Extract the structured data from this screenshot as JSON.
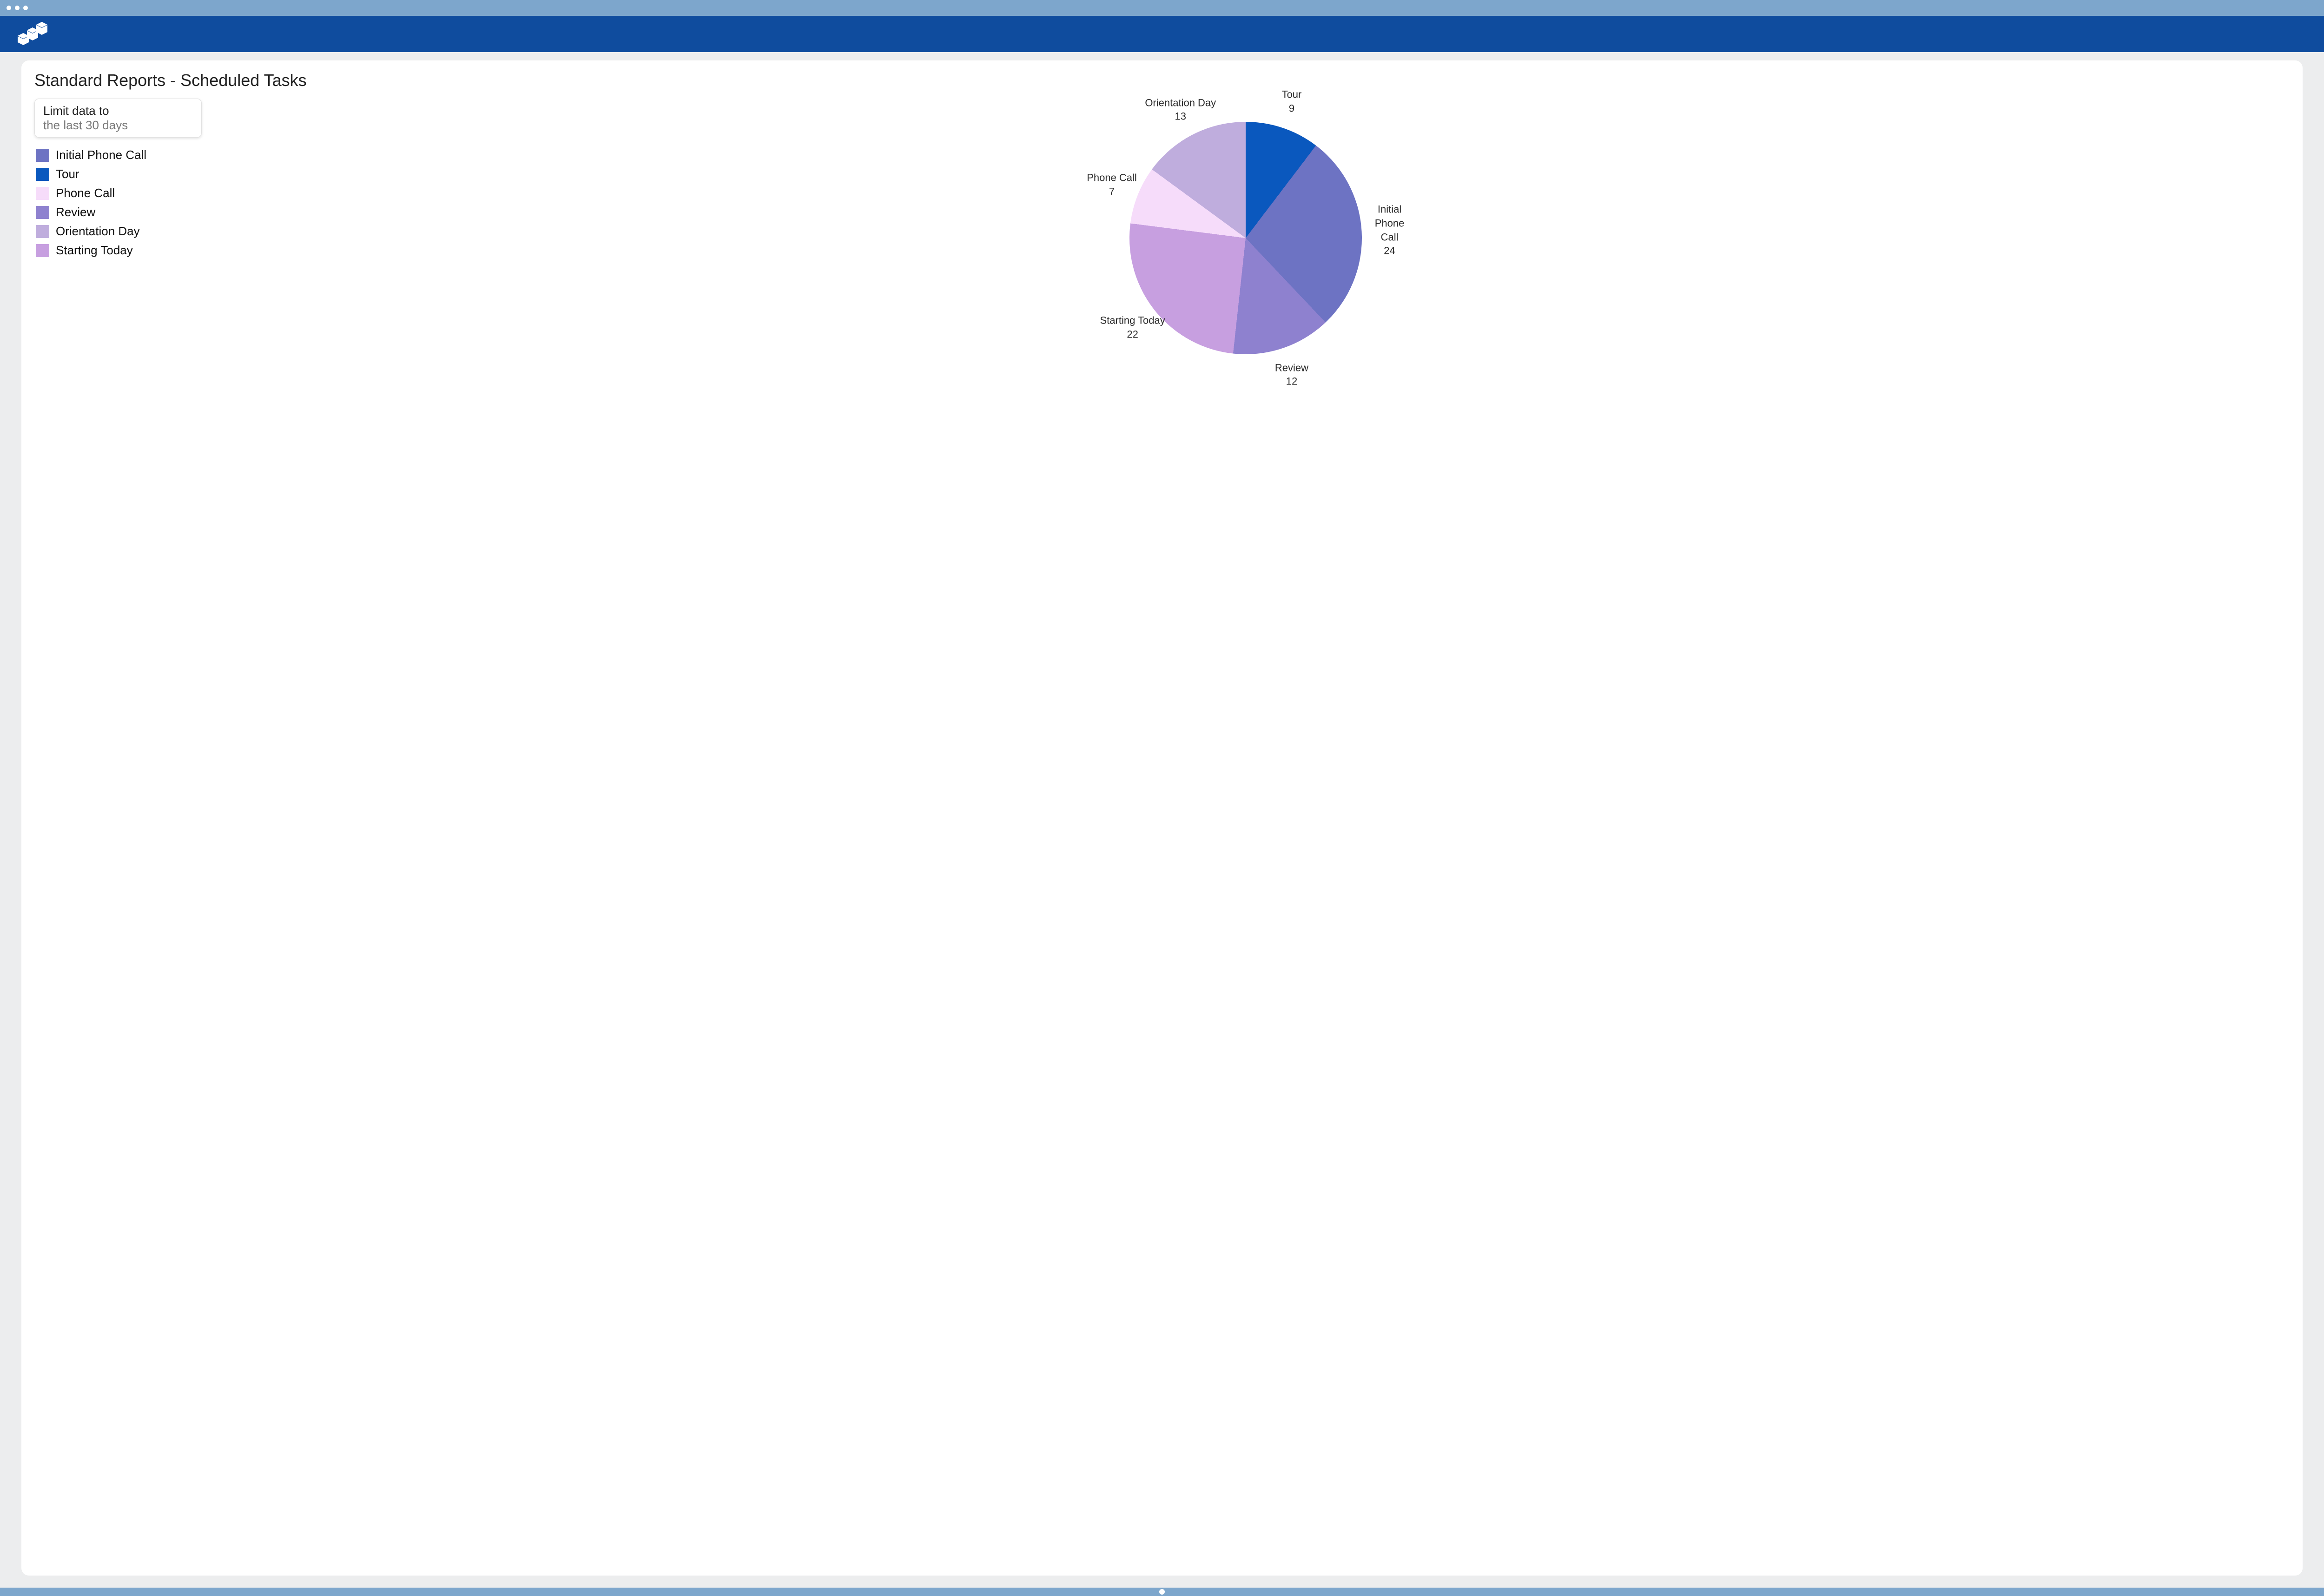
{
  "page": {
    "title": "Standard Reports - Scheduled Tasks"
  },
  "filter": {
    "label": "Limit data to",
    "value": "the last 30 days"
  },
  "legend": [
    {
      "label": "Initial Phone Call",
      "color": "#6d73c3"
    },
    {
      "label": "Tour",
      "color": "#0A58BE"
    },
    {
      "label": "Phone Call",
      "color": "#F6DCFA"
    },
    {
      "label": "Review",
      "color": "#8E81CF"
    },
    {
      "label": "Orientation Day",
      "color": "#BFADDD"
    },
    {
      "label": "Starting Today",
      "color": "#C79FE0"
    }
  ],
  "chart_data": {
    "type": "pie",
    "title": "Standard Reports - Scheduled Tasks",
    "series": [
      {
        "name": "Tour",
        "value": 9,
        "color": "#0A58BE"
      },
      {
        "name": "Initial Phone Call",
        "value": 24,
        "color": "#6d73c3"
      },
      {
        "name": "Review",
        "value": 12,
        "color": "#8E81CF"
      },
      {
        "name": "Starting Today",
        "value": 22,
        "color": "#C79FE0"
      },
      {
        "name": "Phone Call",
        "value": 7,
        "color": "#F6DCFA"
      },
      {
        "name": "Orientation Day",
        "value": 13,
        "color": "#BFADDD"
      }
    ]
  }
}
